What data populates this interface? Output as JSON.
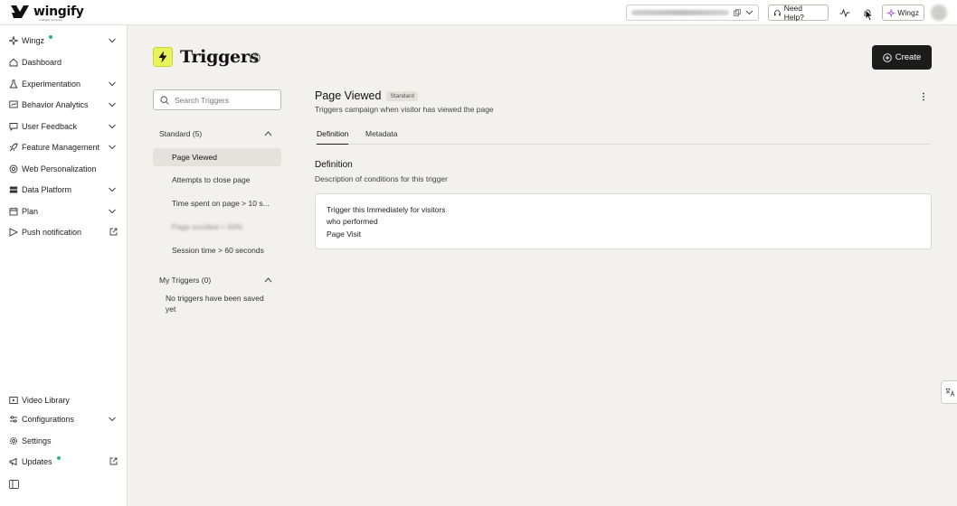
{
  "app": {
    "brand": "wingify",
    "brand_sub": "a Wingify Company"
  },
  "topbar": {
    "need_help_label": "Need Help?",
    "wingz_label": "Wingz"
  },
  "sidebar": {
    "items": [
      {
        "label": "Wingz",
        "icon": "sparkle-icon",
        "has_chevron": true,
        "dot": true
      },
      {
        "label": "Dashboard",
        "icon": "home-icon"
      },
      {
        "label": "Experimentation",
        "icon": "flask-icon",
        "has_chevron": true
      },
      {
        "label": "Behavior Analytics",
        "icon": "analytics-icon",
        "has_chevron": true
      },
      {
        "label": "User Feedback",
        "icon": "chat-icon",
        "has_chevron": true
      },
      {
        "label": "Feature Management",
        "icon": "rocket-icon",
        "has_chevron": true
      },
      {
        "label": "Web Personalization",
        "icon": "target-icon"
      },
      {
        "label": "Data Platform",
        "icon": "database-icon",
        "has_chevron": true
      },
      {
        "label": "Plan",
        "icon": "calendar-icon",
        "has_chevron": true
      },
      {
        "label": "Push notification",
        "icon": "push-icon",
        "external": true
      }
    ],
    "bottom_items": [
      {
        "label": "Video Library",
        "icon": "video-icon"
      },
      {
        "label": "Configurations",
        "icon": "sliders-icon",
        "has_chevron": true
      },
      {
        "label": "Settings",
        "icon": "gear-icon"
      },
      {
        "label": "Updates",
        "icon": "megaphone-icon",
        "external": true,
        "dot": true
      }
    ]
  },
  "page": {
    "title": "Triggers",
    "create_label": "Create"
  },
  "search": {
    "placeholder": "Search Triggers"
  },
  "trigger_groups": {
    "standard_label": "Standard (5)",
    "standard_items": [
      "Page Viewed",
      "Attempts to close page",
      "Time spent on page > 10 s...",
      "Page scrolled > 50%",
      "Session time > 60 seconds"
    ],
    "my_label": "My Triggers (0)",
    "my_empty": "No triggers have been saved yet"
  },
  "detail": {
    "title": "Page Viewed",
    "badge": "Standard",
    "subtitle": "Triggers campaign when visitor has viewed the page",
    "tabs": [
      "Definition",
      "Metadata"
    ],
    "section_title": "Definition",
    "section_sub": "Description of conditions for this trigger",
    "condition_lines": [
      "Trigger this Immediately for visitors",
      "who performed",
      "Page Visit"
    ]
  },
  "colors": {
    "accent_yellow": "#e8f45a",
    "dark_button": "#1c1c1c",
    "status_dot": "#2bb673",
    "page_bg": "#f2f1ee"
  }
}
